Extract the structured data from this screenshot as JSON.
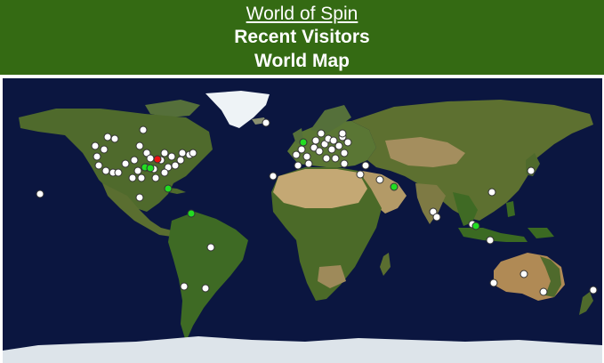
{
  "header": {
    "site_title": "World of Spin",
    "line1": "Recent Visitors",
    "line2": "World Map"
  },
  "colors": {
    "header_bg": "#346a13",
    "ocean": "#0b1640",
    "land": "#4f6e2c",
    "desert": "#b39a67",
    "ice": "#e8eef2",
    "visitor_white": "#ffffff",
    "visitor_green": "#22dd22",
    "visitor_red": "#ee1111"
  }
}
